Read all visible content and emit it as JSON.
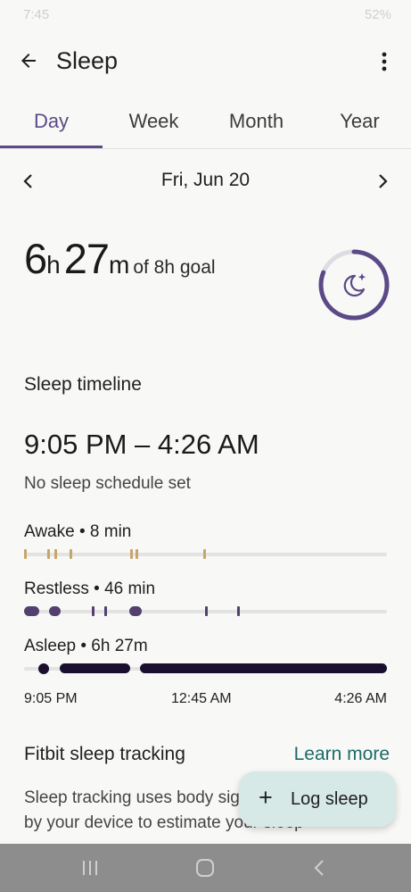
{
  "status": {
    "time": "7:45",
    "battery": "52%"
  },
  "app_bar": {
    "title": "Sleep"
  },
  "tabs": [
    {
      "label": "Day",
      "active": true
    },
    {
      "label": "Week",
      "active": false
    },
    {
      "label": "Month",
      "active": false
    },
    {
      "label": "Year",
      "active": false
    }
  ],
  "date_nav": {
    "label": "Fri, Jun 20"
  },
  "summary": {
    "hours": "6",
    "hours_unit": "h",
    "minutes": "27",
    "minutes_unit": "m",
    "goal_text": "of 8h goal",
    "progress_fraction": 0.81
  },
  "timeline": {
    "section_title": "Sleep timeline",
    "range": "9:05 PM – 4:26 AM",
    "schedule_note": "No sleep schedule set",
    "stages": {
      "awake": {
        "label": "Awake • 8 min"
      },
      "restless": {
        "label": "Restless • 46 min"
      },
      "asleep": {
        "label": "Asleep • 6h 27m"
      }
    },
    "axis": {
      "start": "9:05 PM",
      "mid": "12:45 AM",
      "end": "4:26 AM"
    }
  },
  "footer": {
    "title": "Fitbit sleep tracking",
    "learn_more": "Learn more",
    "description": "Sleep tracking uses body signals detected by your device to estimate your sleep"
  },
  "fab": {
    "label": "Log sleep"
  },
  "colors": {
    "accent": "#5b4a86",
    "awake": "#c9a46a",
    "restless": "#53406f",
    "asleep": "#1a0f2e",
    "link": "#1c6b69",
    "fab_bg": "#d6e9e6"
  }
}
